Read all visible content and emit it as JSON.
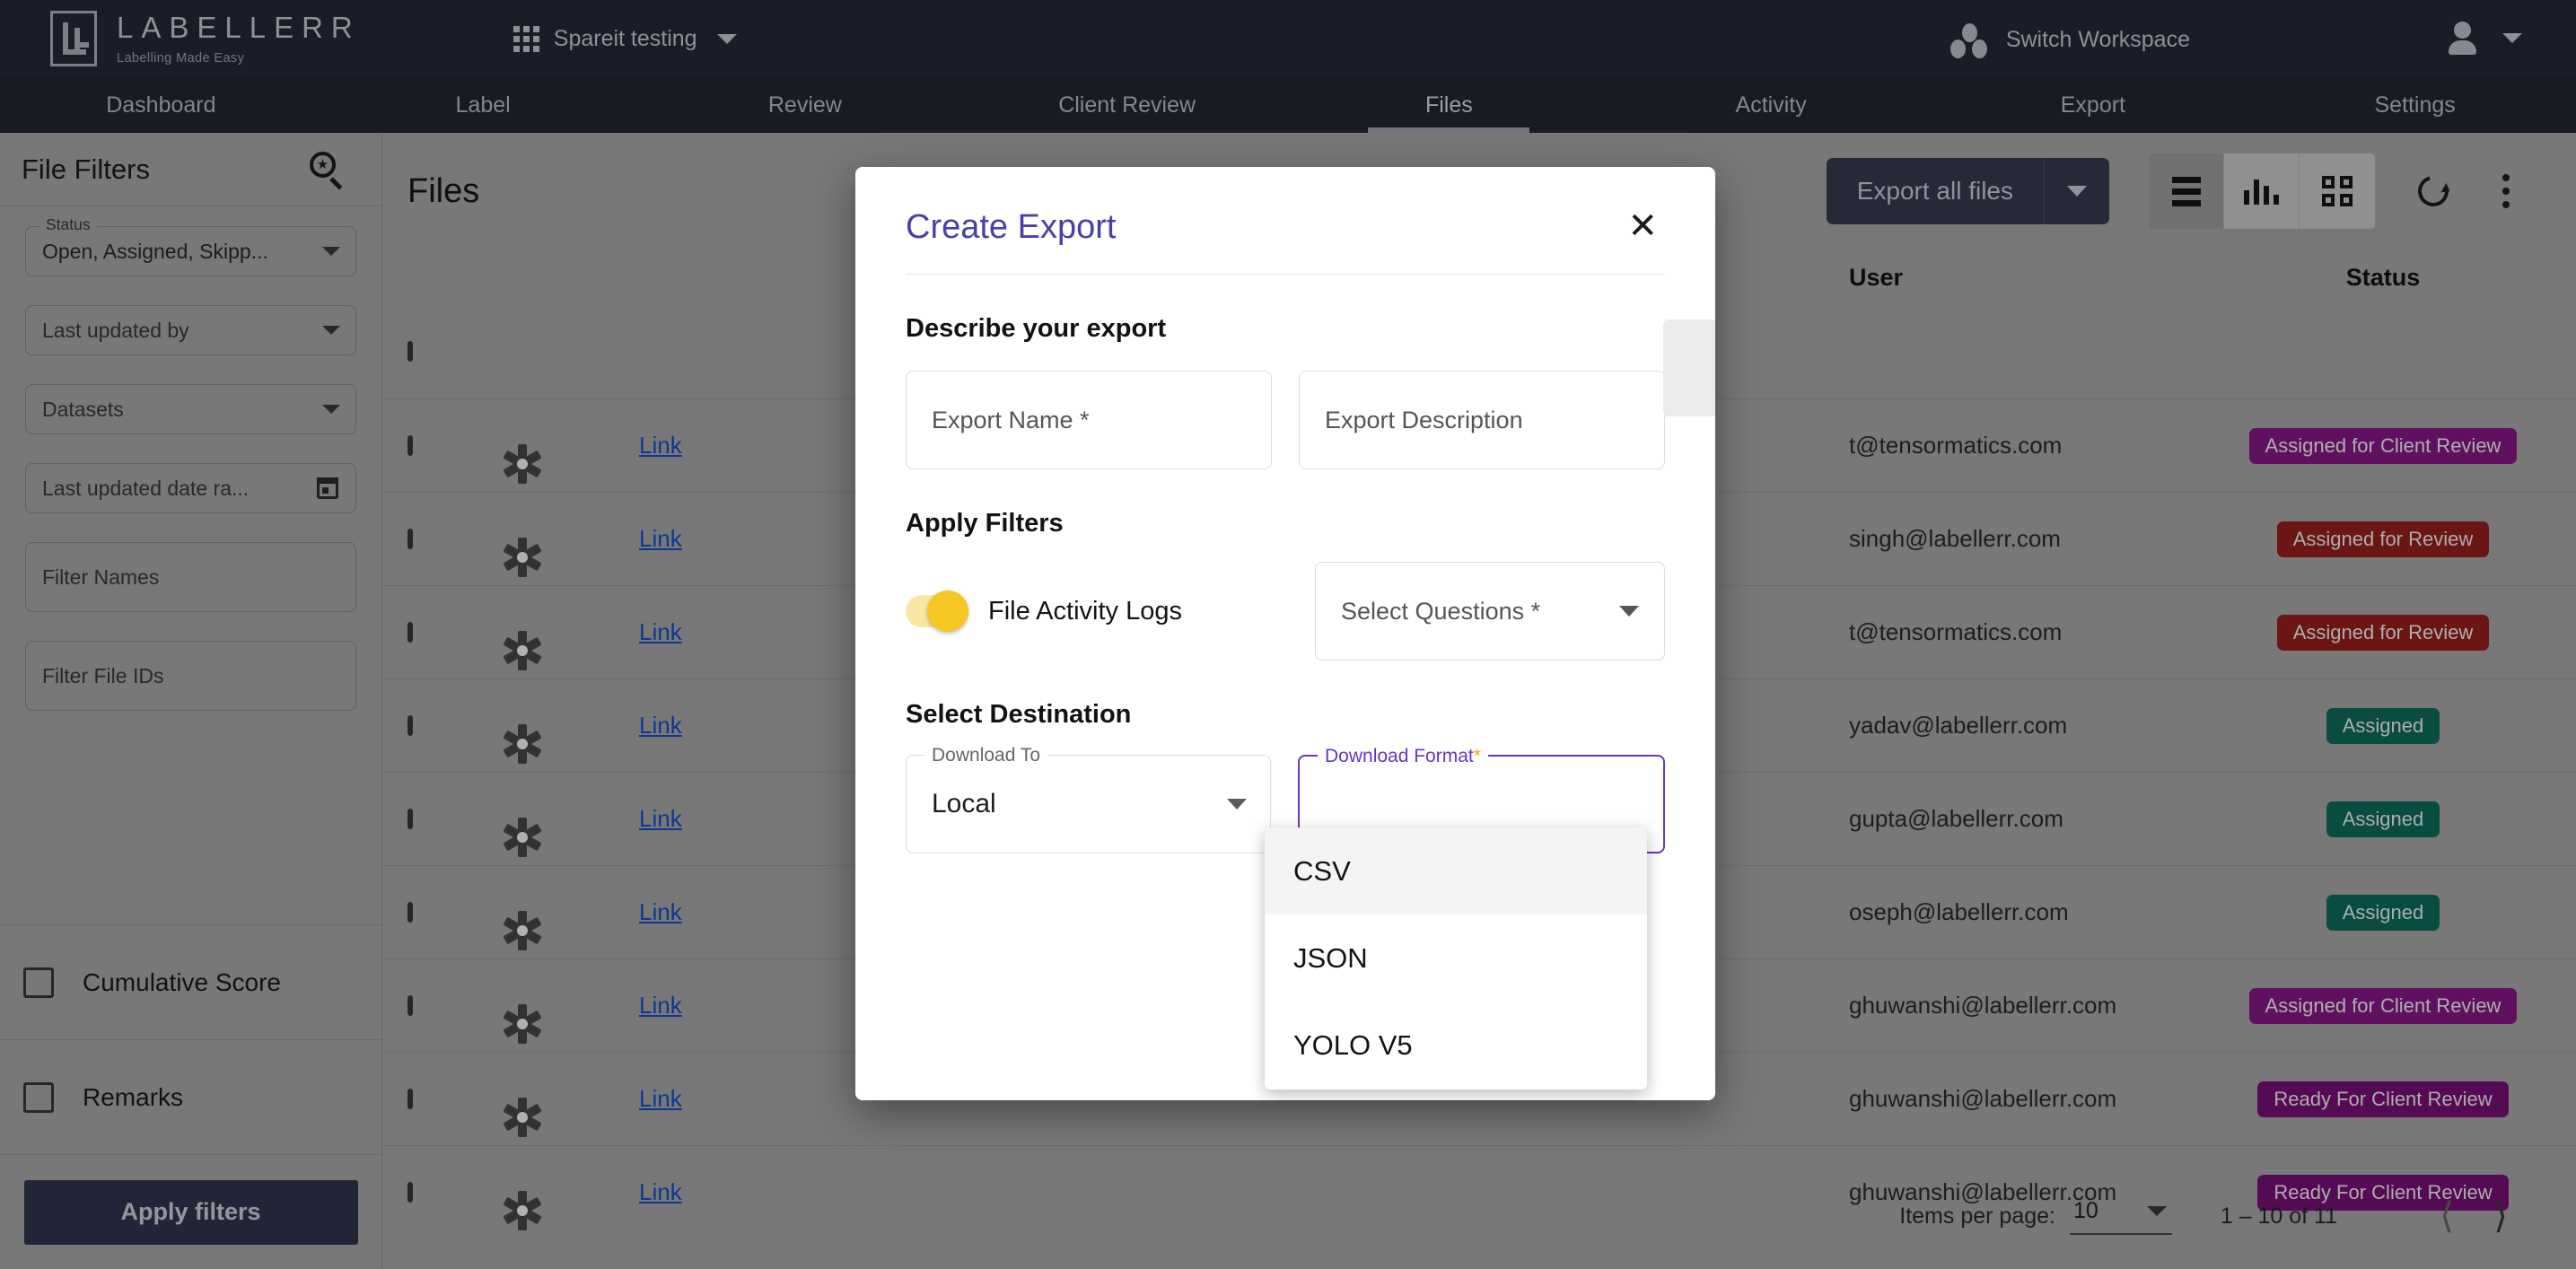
{
  "header": {
    "brand_name": "LABELLERR",
    "brand_tagline": "Labelling Made Easy",
    "workspace": "Spareit testing",
    "switch_workspace": "Switch Workspace",
    "grid_icon": "apps-grid-icon",
    "workspace_caret_icon": "chevron-down-icon",
    "switch_icon": "workspace-dots-icon",
    "avatar_icon": "user-avatar-icon",
    "avatar_caret_icon": "chevron-down-icon"
  },
  "nav": {
    "tabs": [
      {
        "label": "Dashboard",
        "active": false
      },
      {
        "label": "Label",
        "active": false
      },
      {
        "label": "Review",
        "active": false
      },
      {
        "label": "Client Review",
        "active": false
      },
      {
        "label": "Files",
        "active": true
      },
      {
        "label": "Activity",
        "active": false
      },
      {
        "label": "Export",
        "active": false
      },
      {
        "label": "Settings",
        "active": false
      }
    ]
  },
  "sidebar": {
    "title": "File Filters",
    "search_icon": "search-star-icon",
    "status_legend": "Status",
    "status_value": "Open, Assigned, Skipp...",
    "last_updated_by": "Last updated by",
    "datasets": "Datasets",
    "date_range": "Last updated date ra...",
    "date_icon": "calendar-icon",
    "filter_names": "Filter Names",
    "filter_file_ids": "Filter File IDs",
    "cumulative_score": "Cumulative Score",
    "remarks": "Remarks",
    "apply_button": "Apply filters"
  },
  "main": {
    "page_title": "Files",
    "export_all_label": "Export all files",
    "export_caret_icon": "chevron-down-icon",
    "view_list_icon": "list-view-icon",
    "view_chart_icon": "bar-chart-view-icon",
    "view_grid_icon": "grid-view-icon",
    "refresh_icon": "refresh-icon",
    "more_icon": "kebab-menu-icon",
    "columns": {
      "user": "User",
      "status": "Status"
    },
    "link_label": "Link",
    "gear_icon": "settings-gear-icon",
    "rows": [
      {
        "user": "t@tensormatics.com",
        "status": "Assigned for Client Review",
        "status_class": "bd-acr"
      },
      {
        "user": "singh@labellerr.com",
        "status": "Assigned for Review",
        "status_class": "bd-ar"
      },
      {
        "user": "t@tensormatics.com",
        "status": "Assigned for Review",
        "status_class": "bd-ar"
      },
      {
        "user": "yadav@labellerr.com",
        "status": "Assigned",
        "status_class": "bd-a"
      },
      {
        "user": "gupta@labellerr.com",
        "status": "Assigned",
        "status_class": "bd-a"
      },
      {
        "user": "oseph@labellerr.com",
        "status": "Assigned",
        "status_class": "bd-a"
      },
      {
        "user": "ghuwanshi@labellerr.com",
        "status": "Assigned for Client Review",
        "status_class": "bd-acr"
      },
      {
        "user": "ghuwanshi@labellerr.com",
        "status": "Ready For Client Review",
        "status_class": "bd-rcr"
      },
      {
        "user": "ghuwanshi@labellerr.com",
        "status": "Ready For Client Review",
        "status_class": "bd-rcr"
      }
    ],
    "pagination": {
      "items_per_page_label": "Items per page:",
      "items_per_page_value": "10",
      "range": "1 – 10 of 11",
      "prev_icon": "chevron-left-icon",
      "next_icon": "chevron-right-icon"
    }
  },
  "modal": {
    "title": "Create Export",
    "close_icon": "close-icon",
    "section_describe": "Describe your export",
    "export_name_placeholder": "Export Name *",
    "export_description_placeholder": "Export Description",
    "section_filters": "Apply Filters",
    "toggle_label": "File Activity Logs",
    "toggle_state": "on",
    "select_questions_placeholder": "Select Questions *",
    "select_questions_caret_icon": "chevron-down-icon",
    "section_destination": "Select Destination",
    "download_to_legend": "Download To",
    "download_to_value": "Local",
    "download_to_caret_icon": "chevron-down-icon",
    "download_format_legend": "Download Format",
    "download_format_required": "*",
    "format_options": [
      "CSV",
      "JSON",
      "YOLO V5"
    ],
    "format_highlighted": "CSV"
  },
  "colors": {
    "header_bg": "#272a3b",
    "nav_bg": "#242736",
    "accent_purple": "#6b34c4",
    "title_purple": "#4a3fa8",
    "toggle_yellow": "#f6c623",
    "required_amber": "#f0a818",
    "link_blue": "#1452d6",
    "badge_client_review": "#8c1a8c",
    "badge_review": "#9e2020",
    "badge_assigned": "#0c7162",
    "badge_ready_client": "#7d0f7d",
    "apply_btn": "#333751",
    "export_btn": "#3a3d55"
  }
}
